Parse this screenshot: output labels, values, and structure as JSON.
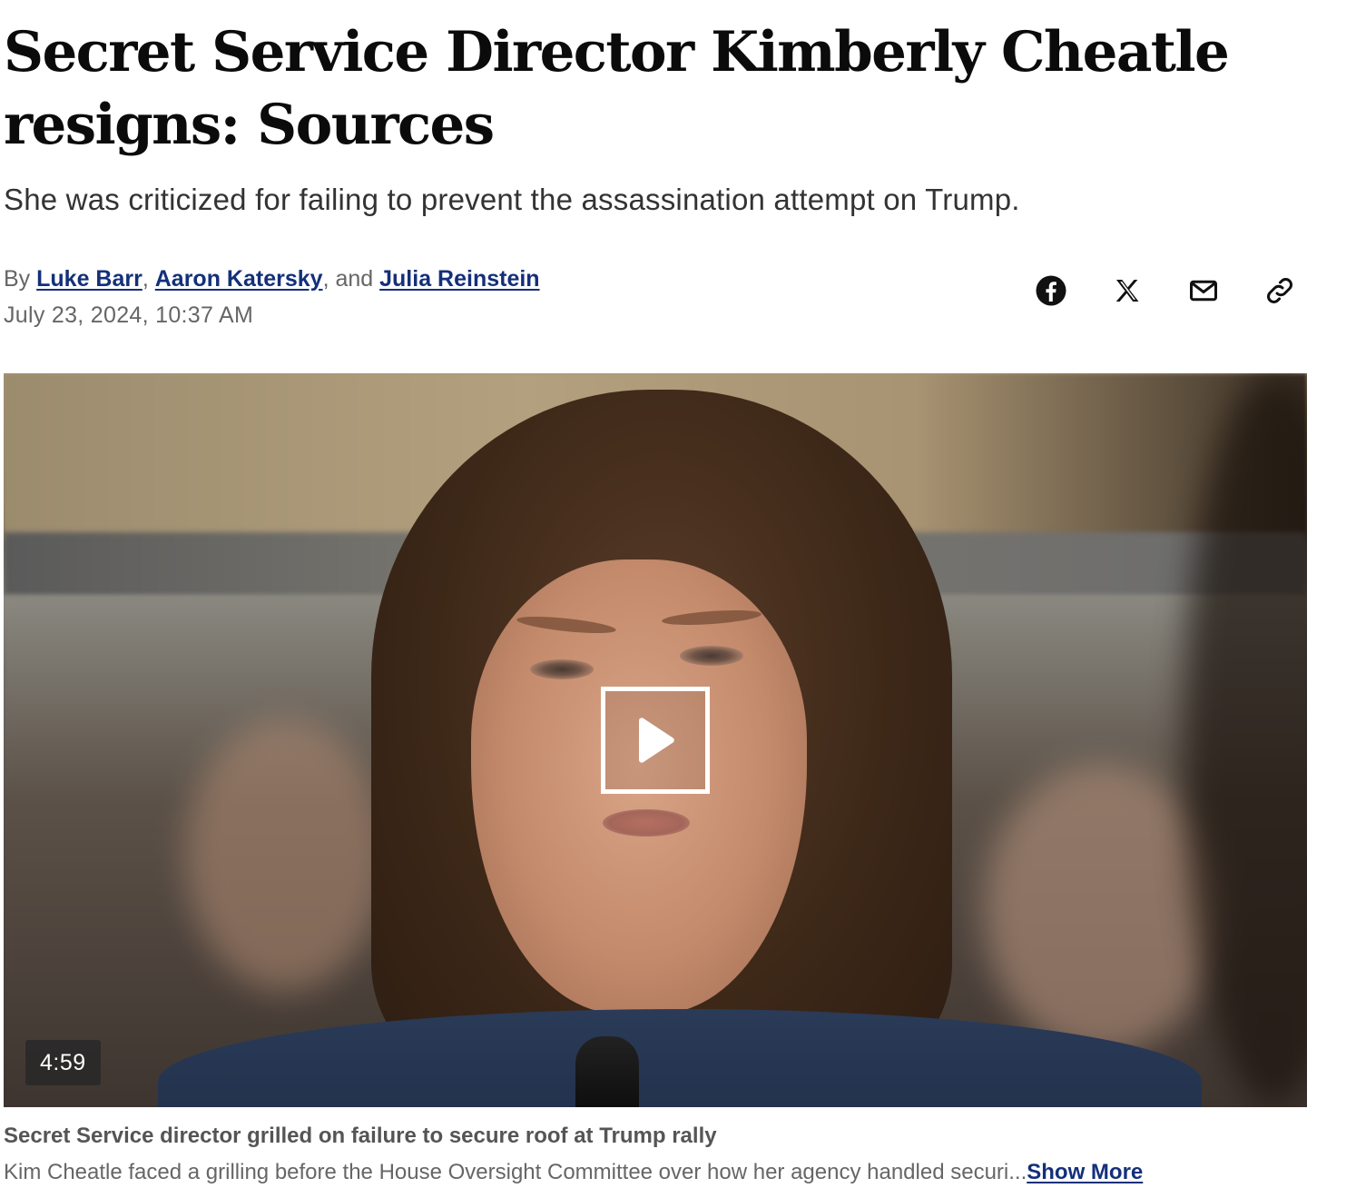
{
  "article": {
    "headline": "Secret Service Director Kimberly Cheatle resigns: Sources",
    "subheadline": "She was criticized for failing to prevent the assassination attempt on Trump.",
    "byline": {
      "prefix": "By ",
      "authors": [
        "Luke Barr",
        "Aaron Katersky",
        "Julia Reinstein"
      ],
      "sep1": ", ",
      "sep2": ", and "
    },
    "date": "July 23, 2024, 10:37 AM"
  },
  "share": {
    "icons": [
      "facebook-icon",
      "x-icon",
      "email-icon",
      "link-icon"
    ]
  },
  "video": {
    "duration": "4:59",
    "caption_title": "Secret Service director grilled on failure to secure roof at Trump rally",
    "caption_description": "Kim Cheatle faced a grilling before the House Oversight Committee over how her agency handled securi...",
    "show_more_label": "Show More"
  },
  "colors": {
    "link": "#14307a",
    "headline": "#0b0b0b",
    "muted": "#666666"
  }
}
